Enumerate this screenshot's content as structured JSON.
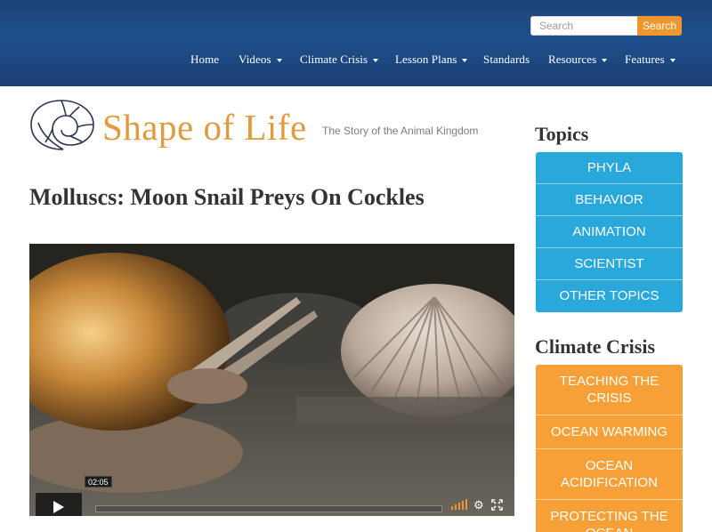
{
  "header": {
    "search": {
      "placeholder": "Search",
      "button_label": "Search"
    },
    "nav": [
      {
        "label": "Home",
        "dropdown": false
      },
      {
        "label": "Videos",
        "dropdown": true
      },
      {
        "label": "Climate Crisis",
        "dropdown": true
      },
      {
        "label": "Lesson Plans",
        "dropdown": true
      },
      {
        "label": "Standards",
        "dropdown": false
      },
      {
        "label": "Resources",
        "dropdown": true
      },
      {
        "label": "Features",
        "dropdown": true
      }
    ]
  },
  "logo": {
    "name": "Shape of Life",
    "tagline": "The Story of the Animal Kingdom"
  },
  "main": {
    "title": "Molluscs: Moon Snail Preys On Cockles",
    "video": {
      "current_time": "02:05"
    }
  },
  "sidebar": {
    "topics": {
      "heading": "Topics",
      "items": [
        "PHYLA",
        "BEHAVIOR",
        "ANIMATION",
        "SCIENTIST",
        "OTHER TOPICS"
      ]
    },
    "climate": {
      "heading": "Climate Crisis",
      "items": [
        "TEACHING THE CRISIS",
        "OCEAN WARMING",
        "OCEAN ACIDIFICATION",
        "PROTECTING THE OCEAN"
      ]
    }
  },
  "colors": {
    "header_blue": "#1f4f8c",
    "search_orange": "#f0962e",
    "topics_blue": "#29a8dc",
    "climate_orange": "#f7a038",
    "logo_orange": "#e29a3e"
  }
}
